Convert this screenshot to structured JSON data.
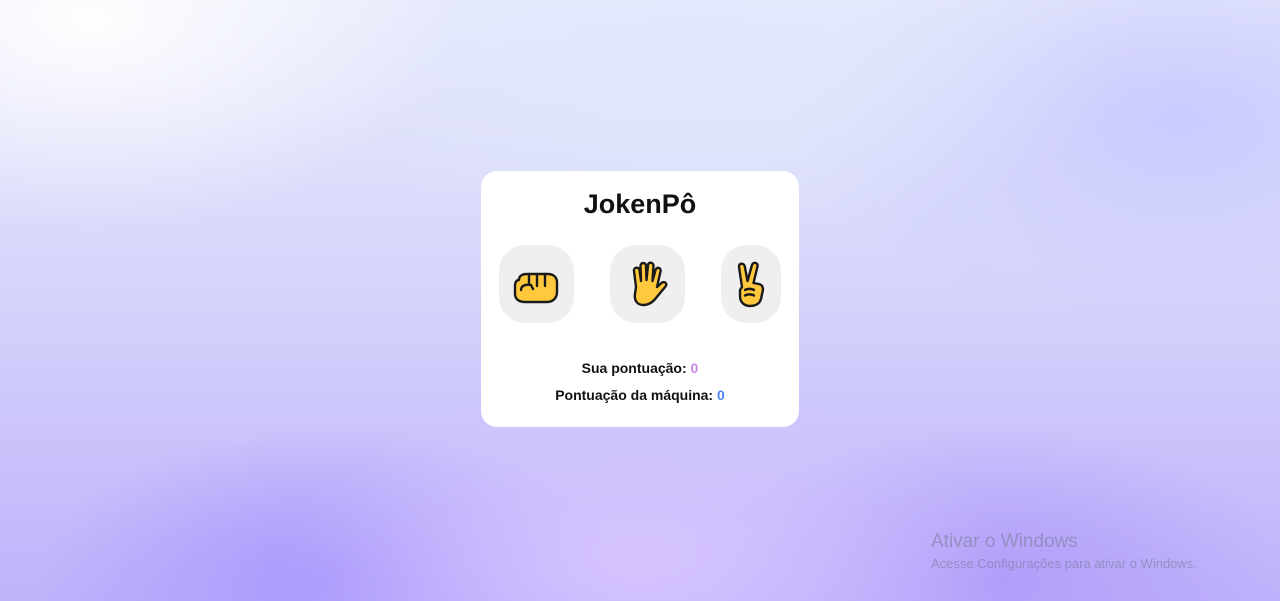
{
  "game": {
    "title": "JokenPô",
    "choices": [
      {
        "name": "rock",
        "icon": "fist-icon"
      },
      {
        "name": "paper",
        "icon": "raised-hand-icon"
      },
      {
        "name": "scissors",
        "icon": "victory-hand-icon"
      }
    ],
    "score": {
      "user_label": "Sua pontuação:",
      "user_value": "0",
      "machine_label": "Pontuação da máquina:",
      "machine_value": "0"
    },
    "colors": {
      "user_score": "#c08be0",
      "machine_score": "#4f86f2",
      "emoji_fill": "#ffc83d"
    }
  },
  "watermark": {
    "title": "Ativar o Windows",
    "subtitle": "Acesse Configurações para ativar o Windows."
  }
}
